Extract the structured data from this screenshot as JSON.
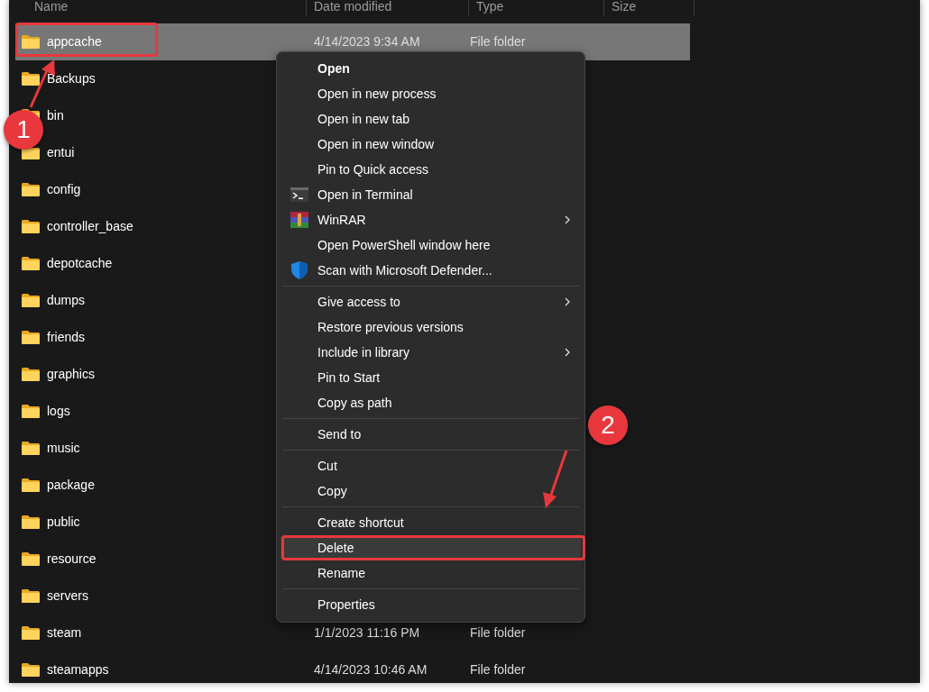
{
  "columns": [
    "Name",
    "Date modified",
    "Type",
    "Size"
  ],
  "rows": [
    {
      "name": "appcache",
      "date_modified": "4/14/2023 9:34 AM",
      "type": "File folder",
      "selected": true
    },
    {
      "name": "Backups",
      "selected": false
    },
    {
      "name": "bin",
      "selected": false
    },
    {
      "name": "entui",
      "selected": false
    },
    {
      "name": "config",
      "selected": false
    },
    {
      "name": "controller_base",
      "selected": false
    },
    {
      "name": "depotcache",
      "selected": false
    },
    {
      "name": "dumps",
      "selected": false
    },
    {
      "name": "friends",
      "selected": false
    },
    {
      "name": "graphics",
      "selected": false
    },
    {
      "name": "logs",
      "selected": false
    },
    {
      "name": "music",
      "selected": false
    },
    {
      "name": "package",
      "selected": false
    },
    {
      "name": "public",
      "selected": false
    },
    {
      "name": "resource",
      "selected": false
    },
    {
      "name": "servers",
      "selected": false
    },
    {
      "name": "steam",
      "date_modified": "1/1/2023 11:16 PM",
      "type": "File folder",
      "selected": false
    },
    {
      "name": "steamapps",
      "date_modified": "4/14/2023 10:46 AM",
      "type": "File folder",
      "selected": false
    }
  ],
  "context_menu": [
    {
      "kind": "plain",
      "label": "Open",
      "default": true,
      "submenu": false,
      "highlighted": false
    },
    {
      "kind": "plain",
      "label": "Open in new process",
      "default": false,
      "submenu": false,
      "highlighted": false
    },
    {
      "kind": "plain",
      "label": "Open in new tab",
      "default": false,
      "submenu": false,
      "highlighted": false
    },
    {
      "kind": "plain",
      "label": "Open in new window",
      "default": false,
      "submenu": false,
      "highlighted": false
    },
    {
      "kind": "plain",
      "label": "Pin to Quick access",
      "default": false,
      "submenu": false,
      "highlighted": false
    },
    {
      "kind": "terminal",
      "label": "Open in Terminal",
      "default": false,
      "submenu": false,
      "highlighted": false
    },
    {
      "kind": "archive",
      "label": "WinRAR",
      "default": false,
      "submenu": true,
      "highlighted": false
    },
    {
      "kind": "plain",
      "label": "Open PowerShell window here",
      "default": false,
      "submenu": false,
      "highlighted": false
    },
    {
      "kind": "shield",
      "label": "Scan with Microsoft Defender...",
      "default": false,
      "submenu": false,
      "highlighted": false
    },
    {
      "kind": "separator"
    },
    {
      "kind": "plain",
      "label": "Give access to",
      "default": false,
      "submenu": true,
      "highlighted": false
    },
    {
      "kind": "plain",
      "label": "Restore previous versions",
      "default": false,
      "submenu": false,
      "highlighted": false
    },
    {
      "kind": "plain",
      "label": "Include in library",
      "default": false,
      "submenu": true,
      "highlighted": false
    },
    {
      "kind": "plain",
      "label": "Pin to Start",
      "default": false,
      "submenu": false,
      "highlighted": false
    },
    {
      "kind": "plain",
      "label": "Copy as path",
      "default": false,
      "submenu": false,
      "highlighted": false
    },
    {
      "kind": "separator"
    },
    {
      "kind": "plain",
      "label": "Send to",
      "default": false,
      "submenu": false,
      "highlighted": false
    },
    {
      "kind": "separator"
    },
    {
      "kind": "plain",
      "label": "Cut",
      "default": false,
      "submenu": false,
      "highlighted": false
    },
    {
      "kind": "plain",
      "label": "Copy",
      "default": false,
      "submenu": false,
      "highlighted": false
    },
    {
      "kind": "separator"
    },
    {
      "kind": "plain",
      "label": "Create shortcut",
      "default": false,
      "submenu": false,
      "highlighted": false
    },
    {
      "kind": "plain",
      "label": "Delete",
      "default": false,
      "submenu": false,
      "highlighted": true
    },
    {
      "kind": "plain",
      "label": "Rename",
      "default": false,
      "submenu": false,
      "highlighted": false
    },
    {
      "kind": "separator"
    },
    {
      "kind": "plain",
      "label": "Properties",
      "default": false,
      "submenu": false,
      "highlighted": false
    }
  ],
  "callouts": [
    {
      "number": "1"
    },
    {
      "number": "2"
    }
  ]
}
